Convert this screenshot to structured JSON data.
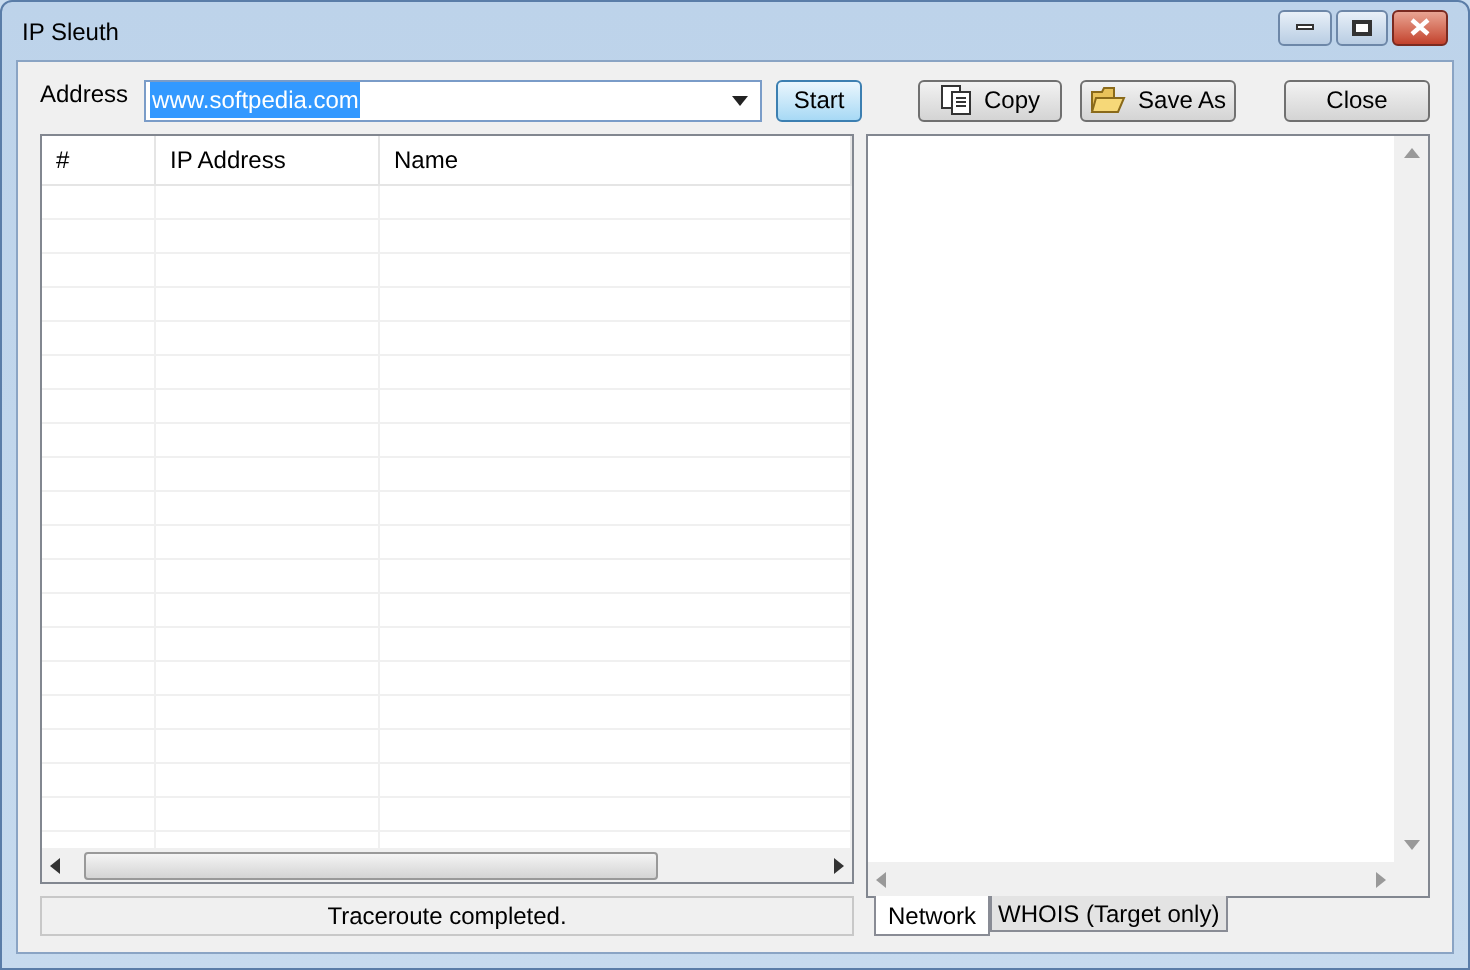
{
  "window": {
    "title": "IP Sleuth"
  },
  "address": {
    "label": "Address",
    "value": "www.softpedia.com"
  },
  "buttons": [
    {
      "kind": "start",
      "label": "Start"
    },
    {
      "kind": "copy",
      "label": "Copy"
    },
    {
      "kind": "save",
      "label": "Save As"
    },
    {
      "kind": "close",
      "label": "Close"
    }
  ],
  "table": {
    "columns": [
      "#",
      "IP Address",
      "Name"
    ]
  },
  "status_bar": "Traceroute completed.",
  "tabs": [
    {
      "label": "Network",
      "selected": true
    },
    {
      "label": "WHOIS (Target only)",
      "selected": false
    }
  ]
}
